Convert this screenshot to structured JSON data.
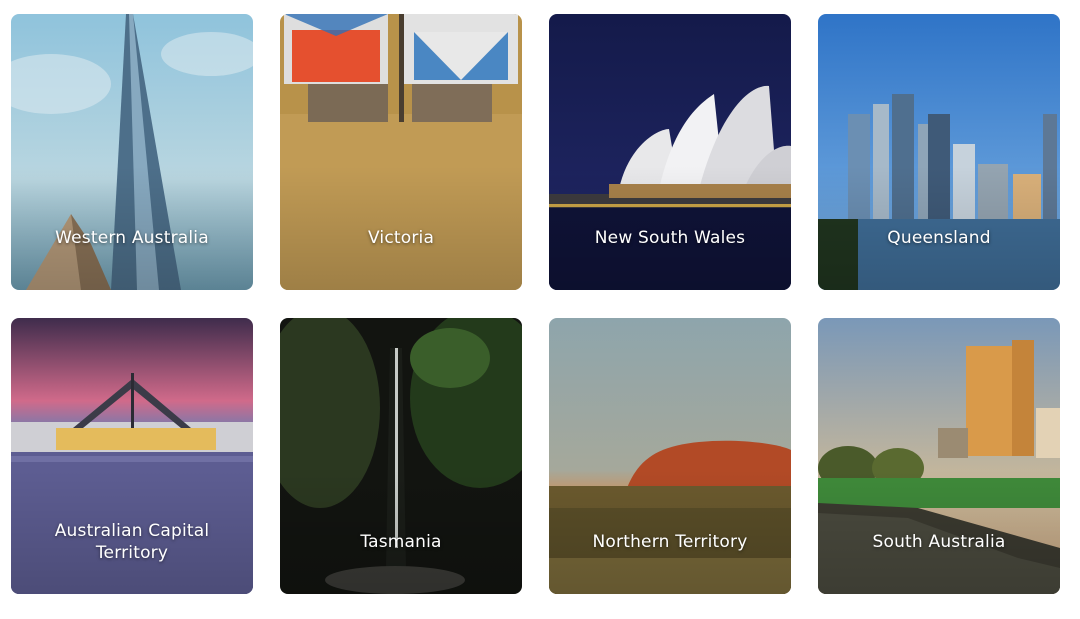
{
  "regions": [
    {
      "name": "Western Australia"
    },
    {
      "name": "Victoria"
    },
    {
      "name": "New South Wales"
    },
    {
      "name": "Queensland"
    },
    {
      "name": "Australian Capital Territory"
    },
    {
      "name": "Tasmania"
    },
    {
      "name": "Northern Territory"
    },
    {
      "name": "South Australia"
    }
  ]
}
